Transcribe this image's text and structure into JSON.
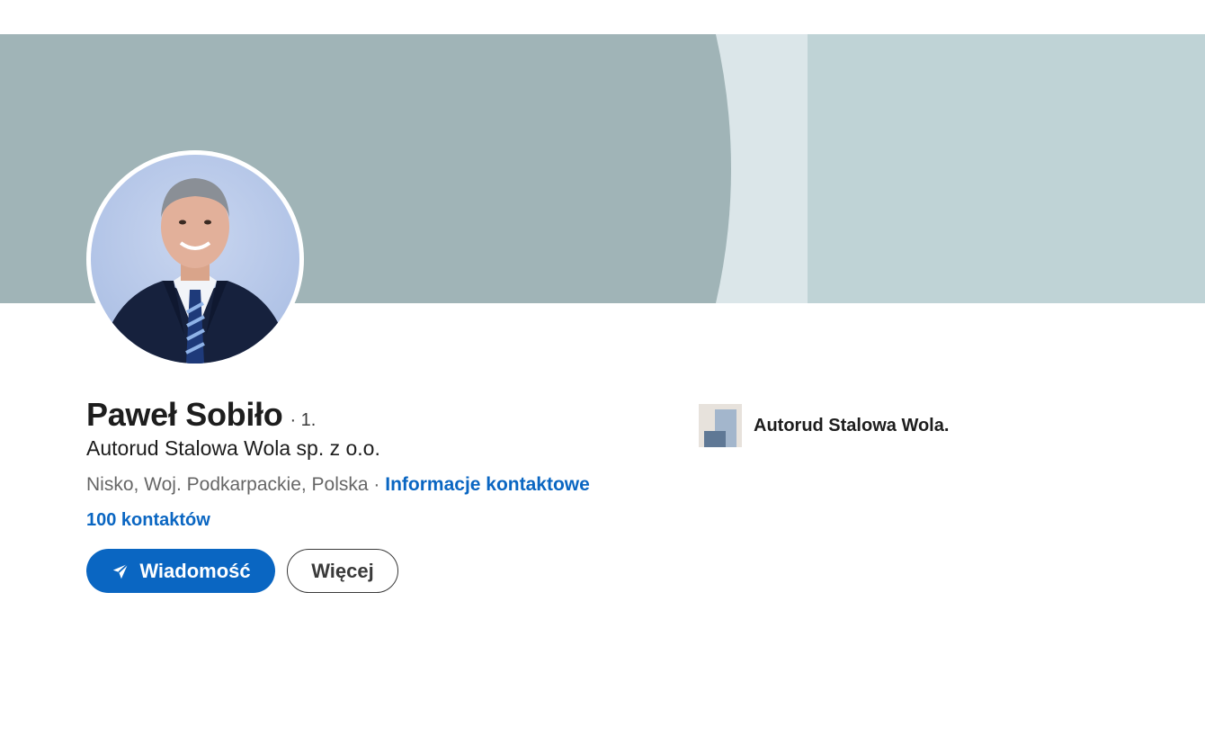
{
  "profile": {
    "name": "Paweł Sobiło",
    "degree": "· 1.",
    "headline": "Autorud Stalowa Wola sp. z o.o.",
    "location": "Nisko, Woj. Podkarpackie, Polska",
    "separator": "·",
    "contact_info_label": "Informacje kontaktowe",
    "connections_label": "100 kontaktów"
  },
  "actions": {
    "message_label": "Wiadomość",
    "more_label": "Więcej"
  },
  "company": {
    "name": "Autorud Stalowa Wola."
  },
  "icons": {
    "message": "send-icon",
    "company": "company-logo-icon"
  },
  "colors": {
    "accent": "#0a66c2",
    "cover_dark": "#a0b4b7",
    "cover_light": "#bfd3d6",
    "cover_stripe": "#dbe6e9"
  }
}
